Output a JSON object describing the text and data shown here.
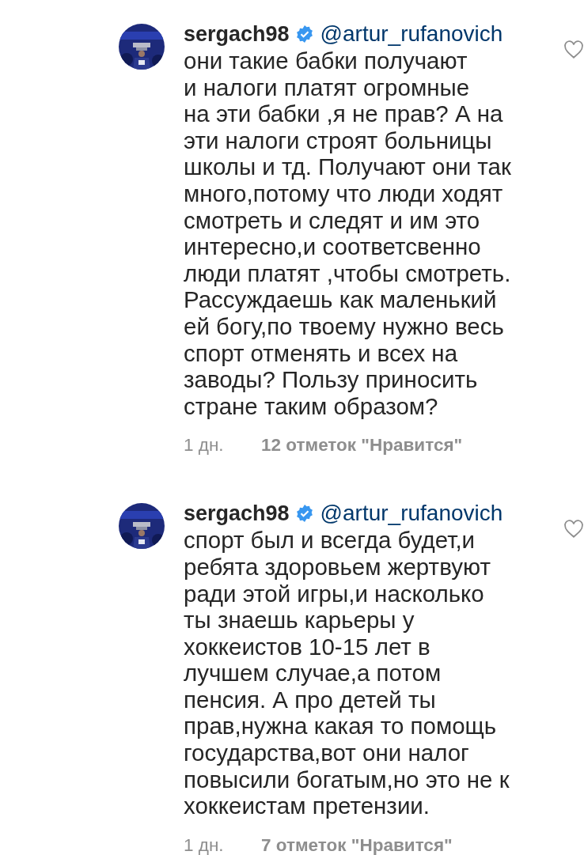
{
  "comments": [
    {
      "username": "sergach98",
      "verified": true,
      "mention": "@artur_rufanovich",
      "liked": false,
      "text": "они такие бабки получают\nи налоги платят огромные\nна эти бабки ,я не прав? А на\nэти налоги строят больницы\nшколы и тд. Получают они так\nмного,потому что люди ходят\nсмотреть и следят и им это\nинтересно,и соответсвенно\nлюди платят ,чтобы смотреть.\nРассуждаешь как маленький\nей богу,по твоему нужно весь\nспорт отменять и всех на\nзаводы? Пользу приносить\nстране таким образом?",
      "time": "1 дн.",
      "likes": "12 отметок \"Нравится\""
    },
    {
      "username": "sergach98",
      "verified": true,
      "mention": "@artur_rufanovich",
      "liked": false,
      "text": "спорт был и всегда будет,и\nребята здоровьем жертвуют\nради этой игры,и насколько\nты знаешь карьеры у\nхоккеистов 10-15 лет в\nлучшем случае,а потом\nпенсия. А про детей ты\nправ,нужна какая то помощь\nгосударства,вот они налог\nповысили богатым,но это не к\nхоккеистам претензии.",
      "time": "1 дн.",
      "likes": "7 отметок \"Нравится\""
    }
  ]
}
